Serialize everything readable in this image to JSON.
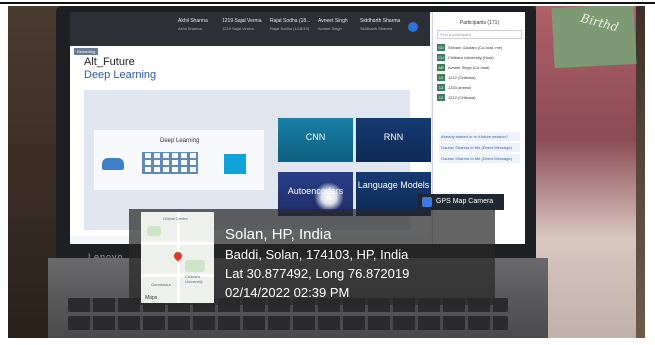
{
  "meeting": {
    "participants_top": [
      {
        "name": "Akhil Sharma",
        "sub": "Akhil Sharma"
      },
      {
        "name": "1219 Sajal Verma",
        "sub": "1219 Sajal Verma"
      },
      {
        "name": "Rajat Sodha (18...",
        "sub": "Rajat Sodha (1/18/10)"
      },
      {
        "name": "Avneet Singh",
        "sub": "Avneet Singh"
      },
      {
        "name": "Siddharth Sharma",
        "sub": "Siddharth Sharma"
      }
    ],
    "recording_tag": "Recording"
  },
  "slide": {
    "title": "Alt_Future",
    "subtitle": "Deep Learning",
    "diagram_label": "Deep Learning",
    "tiles": [
      "CNN",
      "RNN",
      "Autoencoders",
      "Language Models"
    ]
  },
  "panel": {
    "title": "Participants (171)",
    "search_placeholder": "Find a participant",
    "items": [
      {
        "initials": "SD",
        "name": "Shivam Gautam (Co-host, me)"
      },
      {
        "initials": "CU",
        "name": "Chitkara University (Host)"
      },
      {
        "initials": "AR",
        "name": "Avneet Singh (Co-host)"
      },
      {
        "initials": "12",
        "name": "1212 (Chitkara)"
      },
      {
        "initials": "13",
        "name": "1333 aneesh"
      },
      {
        "initials": "12",
        "name": "1212 (Chitkara)"
      }
    ],
    "chat_messages": [
      "Already started or is it future session?",
      "Gaurav Sharma to Me (Direct Message)",
      "Gaurav Sharma to Me (Direct Message)"
    ]
  },
  "gps_badge": "GPS Map Camera",
  "overlay": {
    "city": "Solan, HP, India",
    "address": "Baddi, Solan, 174103, HP, India",
    "coords": "Lat 30.877492, Long 76.872019",
    "datetime": "02/14/2022 02:39 PM",
    "map_labels": [
      "Global Centre",
      "Chitkara University",
      "Gurudwara"
    ],
    "map_logo": "Maps"
  },
  "laptop_brand": "Lenovo",
  "card_text": "Birthd"
}
